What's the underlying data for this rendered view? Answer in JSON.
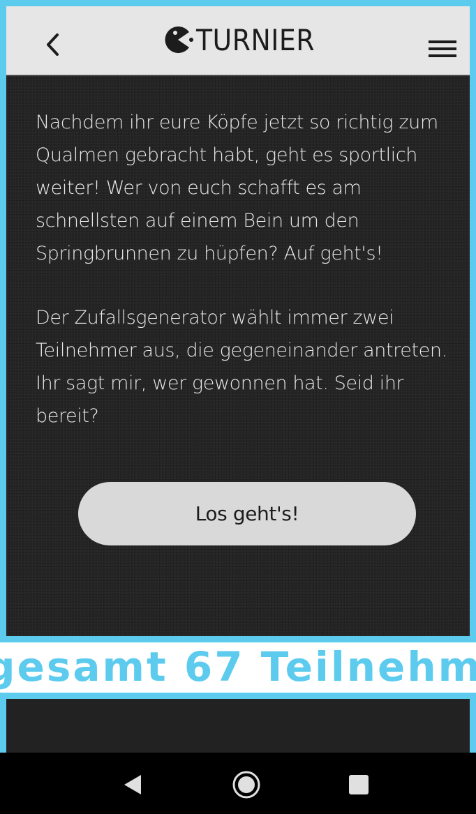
{
  "header": {
    "title": "TURNIER",
    "back_icon": "chevron-left-icon",
    "logo_icon": "pacman-logo-icon",
    "menu_icon": "hamburger-menu-icon"
  },
  "main": {
    "paragraph_1": "Nachdem ihr eure Köpfe jetzt so richtig zum Qualmen gebracht habt, geht es sportlich weiter! Wer von euch schafft es am schnellsten auf einem Bein um den Springbrunnen zu hüpfen? Auf geht's!",
    "paragraph_2": "Der Zufallsgenerator wählt immer zwei Teilnehmer aus, die gegeneinander antreten. Ihr sagt mir, wer gewonnen hat. Seid ihr bereit?",
    "start_button_label": "Los geht's!"
  },
  "banner": {
    "text": "gesamt 67 Teilnehm"
  },
  "system_nav": {
    "back_icon": "triangle-back-icon",
    "home_icon": "circle-home-icon",
    "recents_icon": "square-recents-icon"
  },
  "colors": {
    "frame_blue": "#5ccbee",
    "header_bg": "#e6e6e6",
    "content_bg": "#242424",
    "button_bg": "#d9d9d9"
  }
}
